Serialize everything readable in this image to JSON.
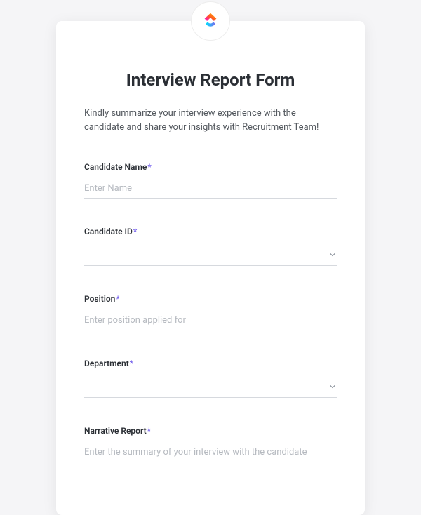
{
  "form": {
    "title": "Interview Report Form",
    "description": "Kindly summarize your interview experience with the candidate and share your insights with Recruitment Team!",
    "required_mark": "*"
  },
  "fields": {
    "candidate_name": {
      "label": "Candidate Name",
      "placeholder": "Enter Name"
    },
    "candidate_id": {
      "label": "Candidate ID",
      "selected": "–"
    },
    "position": {
      "label": "Position",
      "placeholder": "Enter position applied for"
    },
    "department": {
      "label": "Department",
      "selected": "–"
    },
    "narrative_report": {
      "label": "Narrative Report",
      "placeholder": "Enter the summary of your interview with the candidate"
    }
  }
}
